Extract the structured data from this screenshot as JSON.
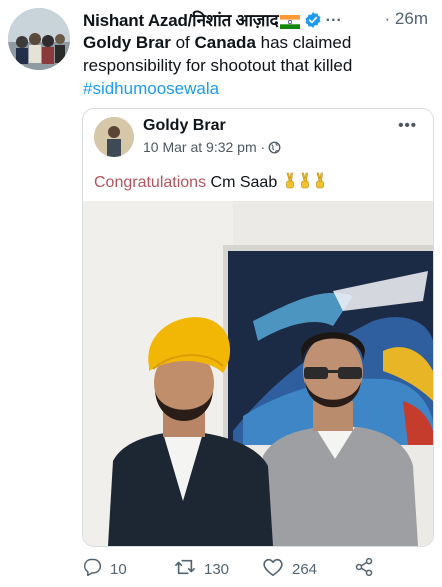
{
  "tweet": {
    "author_name": "Nishant Azad/निशांत आज़ाद",
    "more": "...",
    "time": "26m",
    "text_part1": "Goldy Brar",
    "text_part2": " of ",
    "text_part3": "Canada",
    "text_part4": " has claimed responsibility for shootout that killed ",
    "hashtag": "#sidhumoosewala"
  },
  "embedded_post": {
    "name": "Goldy Brar",
    "meta": "10 Mar at 9:32 pm ·",
    "more": "•••",
    "congrats": "Congratulations",
    "rest": " Cm Saab"
  },
  "actions": {
    "replies": "10",
    "retweets": "130",
    "likes": "264"
  },
  "colors": {
    "hashtag": "#1d9bf0",
    "verified": "#1d9bf0",
    "congrats": "#b5535f",
    "turban": "#f2b705"
  },
  "icons": [
    "verified-badge-icon",
    "india-flag-icon",
    "globe-icon",
    "victory-hand-icon",
    "reply-icon",
    "retweet-icon",
    "like-icon",
    "share-icon"
  ]
}
